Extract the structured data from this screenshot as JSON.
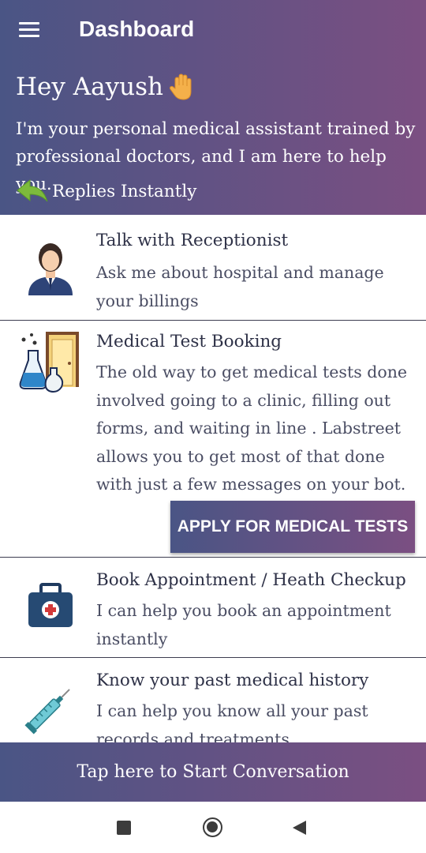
{
  "appbar": {
    "title": "Dashboard",
    "menu_icon": "hamburger-menu-icon"
  },
  "header": {
    "greeting": "Hey Aayush",
    "greeting_icon": "waving-hand-icon",
    "intro": "I'm your personal medical assistant trained by professional doctors, and I am here to help you.",
    "replies_label": "Replies Instantly",
    "replies_icon": "reply-arrow-icon"
  },
  "items": [
    {
      "title": "Talk with Receptionist",
      "description": "Ask me about hospital and manage your billings",
      "icon": "receptionist-icon"
    },
    {
      "title": "Medical Test Booking",
      "description": "The old way to get medical tests done involved going to a clinic, filling out forms, and waiting in line . Labstreet allows you to get most of that done with just a few messages on your bot.",
      "icon": "lab-flask-icon",
      "action_label": "APPLY FOR MEDICAL TESTS"
    },
    {
      "title": "Book Appointment / Heath Checkup",
      "description": "I can help you book an appointment instantly",
      "icon": "medical-kit-icon"
    },
    {
      "title": "Know your past medical history",
      "description": "I can help you know all your past records and treatments",
      "icon": "syringe-icon"
    }
  ],
  "start_bar": {
    "label": "Tap here to Start Conversation"
  },
  "colors": {
    "gradient_start": "#4a5585",
    "gradient_end": "#7b4f82",
    "text_dark": "#2e3147"
  }
}
